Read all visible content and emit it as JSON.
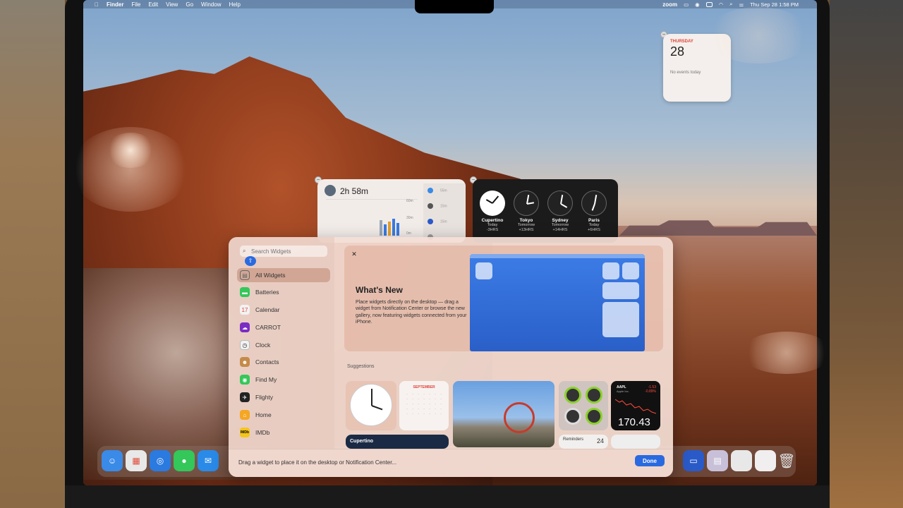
{
  "menubar": {
    "app_name": "Finder",
    "menus": [
      "File",
      "Edit",
      "View",
      "Go",
      "Window",
      "Help"
    ],
    "status_zoom": "zoom",
    "datetime": "Thu Sep 28  1:58 PM"
  },
  "calendar_widget": {
    "weekday": "THURSDAY",
    "date": "28",
    "events": "No events today"
  },
  "screentime_widget": {
    "total": "2h 58m",
    "axis": [
      "60m",
      "30m",
      "0m"
    ],
    "side_rows": [
      "55m",
      "15m",
      "15m",
      ""
    ]
  },
  "world_clock_widget": {
    "clocks": [
      {
        "city": "Cupertino",
        "day": "Today",
        "offset": "-3HRS"
      },
      {
        "city": "Tokyo",
        "day": "Tomorrow",
        "offset": "+13HRS"
      },
      {
        "city": "Sydney",
        "day": "Tomorrow",
        "offset": "+14HRS"
      },
      {
        "city": "Paris",
        "day": "Today",
        "offset": "+6HRS"
      }
    ]
  },
  "gallery": {
    "search_placeholder": "Search Widgets",
    "sidebar": [
      {
        "label": "All Widgets",
        "icon": "grid-icon",
        "color": "#888888",
        "selected": true
      },
      {
        "label": "Batteries",
        "icon": "battery-icon",
        "color": "#34c759"
      },
      {
        "label": "Calendar",
        "icon": "calendar-icon",
        "color": "#f2f2f2"
      },
      {
        "label": "CARROT",
        "icon": "carrot-cloud-icon",
        "color": "#7a2cc4"
      },
      {
        "label": "Clock",
        "icon": "clock-icon",
        "color": "#f2f2f2"
      },
      {
        "label": "Contacts",
        "icon": "contacts-icon",
        "color": "#c58a4a"
      },
      {
        "label": "Find My",
        "icon": "find-my-icon",
        "color": "#34c759"
      },
      {
        "label": "Flighty",
        "icon": "plane-icon",
        "color": "#222222"
      },
      {
        "label": "Home",
        "icon": "home-icon",
        "color": "#f5a623"
      },
      {
        "label": "IMDb",
        "icon": "imdb-icon",
        "color": "#f5c518"
      }
    ],
    "whats_new": {
      "title": "What's New",
      "body": "Place widgets directly on the desktop — drag a widget from Notification Center or browse the new gallery, now featuring widgets connected from your iPhone."
    },
    "suggestions_label": "Suggestions",
    "suggestions": {
      "calendar_month": "SEPTEMBER",
      "stock_symbol": "AAPL",
      "stock_name": "Apple Inc.",
      "stock_change": "-1.53",
      "stock_pct": "-0.89%",
      "stock_price": "170.43",
      "world_clock_city": "Cupertino",
      "reminders_label": "Reminders",
      "reminders_count": "24"
    },
    "footer_text": "Drag a widget to place it on the desktop or Notification Center...",
    "done_label": "Done"
  },
  "dock": {
    "apps": [
      {
        "name": "finder-icon",
        "color": "#3a8ae8"
      },
      {
        "name": "launchpad-icon",
        "color": "#e8e8e8"
      },
      {
        "name": "safari-icon",
        "color": "#2a7ae0"
      },
      {
        "name": "messages-icon",
        "color": "#34c759"
      },
      {
        "name": "mail-icon",
        "color": "#2a8ae8"
      }
    ]
  }
}
